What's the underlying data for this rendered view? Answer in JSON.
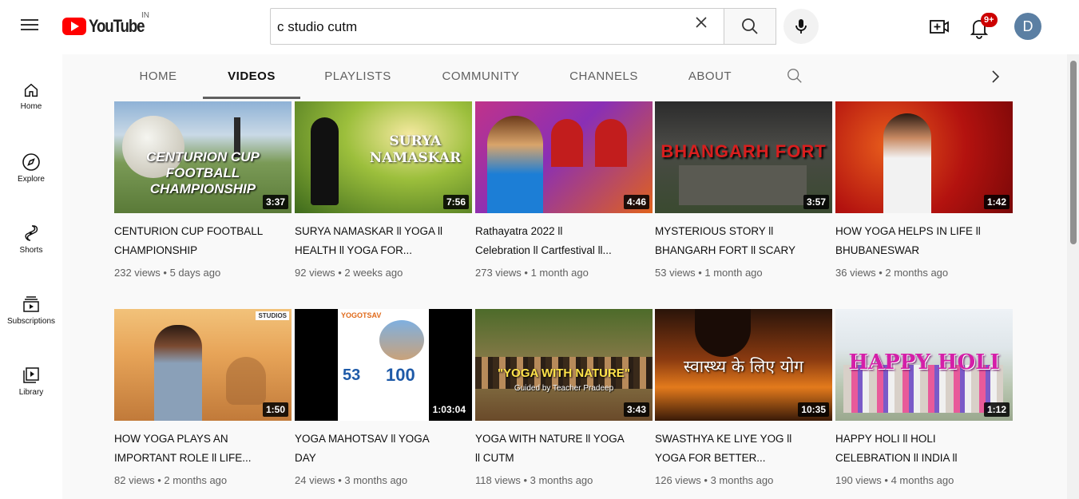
{
  "logo": {
    "text": "YouTube",
    "country": "IN"
  },
  "search": {
    "value": "c studio cutm",
    "placeholder": "Search"
  },
  "notifications": {
    "badge": "9+"
  },
  "avatar": {
    "letter": "D"
  },
  "sidebar": {
    "items": [
      {
        "label": "Home",
        "icon": "home-icon"
      },
      {
        "label": "Explore",
        "icon": "compass-icon"
      },
      {
        "label": "Shorts",
        "icon": "shorts-icon"
      },
      {
        "label": "Subscriptions",
        "icon": "subscriptions-icon"
      },
      {
        "label": "Library",
        "icon": "library-icon"
      }
    ]
  },
  "tabs": [
    {
      "label": "HOME"
    },
    {
      "label": "VIDEOS",
      "active": true
    },
    {
      "label": "PLAYLISTS"
    },
    {
      "label": "COMMUNITY"
    },
    {
      "label": "CHANNELS"
    },
    {
      "label": "ABOUT"
    }
  ],
  "videos": [
    {
      "thumb_text": "CENTURION CUP FOOTBALL CHAMPIONSHIP",
      "duration": "3:37",
      "title_line1": "CENTURION CUP FOOTBALL",
      "title_line2": "CHAMPIONSHIP",
      "meta": "232 views • 5 days ago"
    },
    {
      "thumb_text": "SURYA NAMASKAR",
      "duration": "7:56",
      "title_line1": "SURYA NAMASKAR ll YOGA ll",
      "title_line2": "HEALTH ll YOGA FOR...",
      "meta": "92 views • 2 weeks ago"
    },
    {
      "thumb_text": "",
      "duration": "4:46",
      "title_line1": "Rathayatra 2022 ll",
      "title_line2": "Celebration ll Cartfestival ll...",
      "meta": "273 views • 1 month ago"
    },
    {
      "thumb_text": "BHANGARH FORT",
      "duration": "3:57",
      "title_line1": "MYSTERIOUS STORY ll",
      "title_line2": "BHANGARH FORT ll SCARY",
      "meta": "53 views • 1 month ago"
    },
    {
      "thumb_text": "",
      "duration": "1:42",
      "title_line1": "HOW YOGA HELPS IN LIFE ll",
      "title_line2": "BHUBANESWAR",
      "meta": "36 views • 2 months ago"
    },
    {
      "thumb_text": "STUDIOS",
      "duration": "1:50",
      "title_line1": "HOW YOGA PLAYS AN",
      "title_line2": "IMPORTANT ROLE ll LIFE...",
      "meta": "82 views • 2 months ago"
    },
    {
      "thumb_text": "YOGOTSAV",
      "thumb_text2": "53",
      "thumb_text3": "100",
      "duration": "1:03:04",
      "title_line1": "YOGA MAHOTSAV ll YOGA",
      "title_line2": "DAY",
      "meta": "24 views • 3 months ago"
    },
    {
      "thumb_text": "\"YOGA WITH NATURE\"",
      "thumb_text2": "Guided by Teacher Pradeep",
      "duration": "3:43",
      "title_line1": "YOGA WITH NATURE ll YOGA",
      "title_line2": "ll CUTM",
      "meta": "118 views • 3 months ago"
    },
    {
      "thumb_text": "स्वास्थ्य के लिए योग",
      "duration": "10:35",
      "title_line1": "SWASTHYA KE LIYE YOG ll",
      "title_line2": "YOGA FOR BETTER...",
      "meta": "126 views • 3 months ago"
    },
    {
      "thumb_text": "HAPPY HOLI",
      "duration": "1:12",
      "title_line1": "HAPPY HOLI ll HOLI",
      "title_line2": "CELEBRATION ll INDIA ll",
      "meta": "190 views • 4 months ago"
    }
  ]
}
